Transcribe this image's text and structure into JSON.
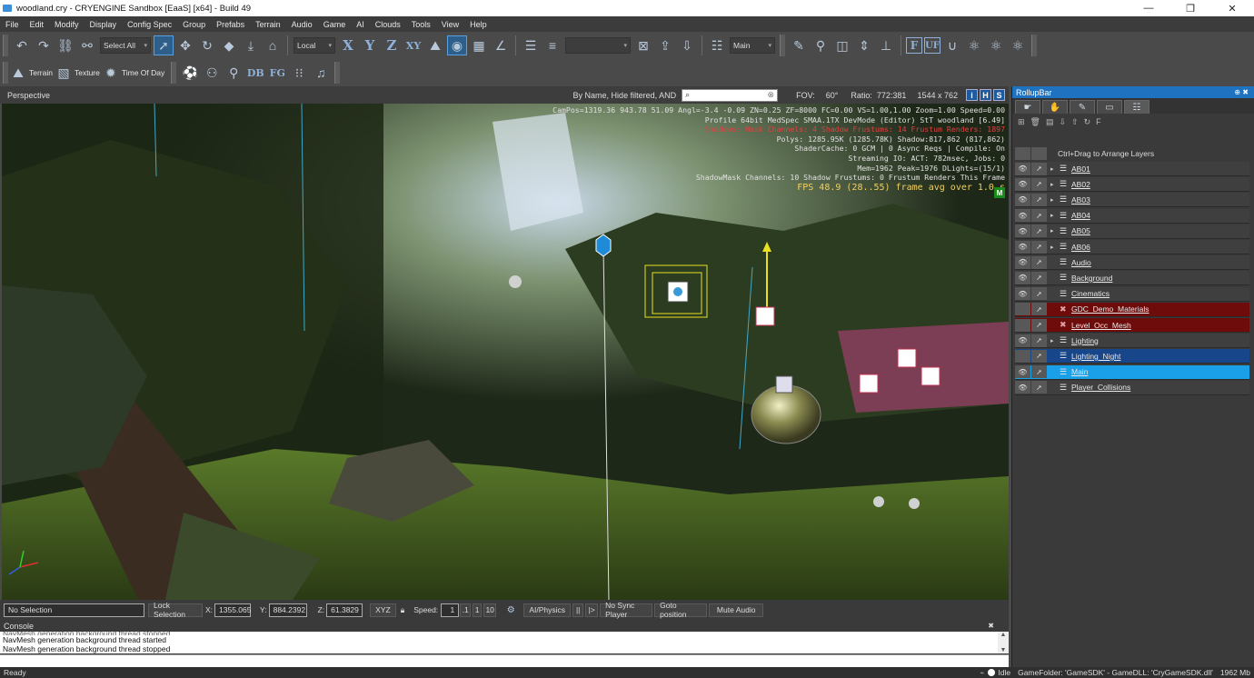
{
  "window": {
    "title": "woodland.cry - CRYENGINE Sandbox [EaaS] [x64] - Build 49"
  },
  "menu": [
    "File",
    "Edit",
    "Modify",
    "Display",
    "Config Spec",
    "Group",
    "Prefabs",
    "Terrain",
    "Audio",
    "Game",
    "AI",
    "Clouds",
    "Tools",
    "View",
    "Help"
  ],
  "toolbar": {
    "select_all": "Select All",
    "coord_space": "Local",
    "layer_combo": "Main",
    "axis_letters": [
      "X",
      "Y",
      "Z",
      "XY"
    ],
    "flags": [
      "F",
      "UF"
    ],
    "terrain": "Terrain",
    "texture": "Texture",
    "time_of_day": "Time Of Day",
    "db": "DB",
    "fg": "FG"
  },
  "viewport": {
    "title": "Perspective",
    "filter_text": "By Name, Hide filtered, AND",
    "search_value": "",
    "fov_label": "FOV:",
    "fov_value": "60°",
    "ratio_label": "Ratio:",
    "ratio_value": "772:381",
    "resolution": "1544 x 762",
    "view_buttons": [
      "i",
      "H",
      "S"
    ],
    "stats": [
      "CamPos=1319.36 943.78 51.09 Angl=-3.4 -0.09 ZN=0.25 ZF=8000 FC=0.00 VS=1.00,1.00 Zoom=1.00 Speed=0.00",
      "Profile 64bit MedSpec SMAA.1TX DevMode (Editor) StT woodland [6.49]",
      "Shadows: Mask Channels: 4 Shadow Frustums: 14 Frustum Renders: 1897",
      "Polys: 1285.95K (1285.78K) Shadow:817,862 (817,862)",
      "ShaderCache: 0 GCM | 0 Async Reqs | Compile: On",
      "Streaming IO: ACT: 782msec, Jobs: 0",
      "Mem=1962 Peak=1976 DLights=(15/1)",
      "ShadowMask Channels: 10 Shadow Frustums: 0 Frustum Renders This Frame",
      "FPS 48.9 (28..55) frame avg over 1.0 s"
    ],
    "m_badge": "M"
  },
  "status": {
    "selection": "No Selection",
    "lock_selection": "Lock Selection",
    "x_label": "X:",
    "x_value": "1355.065",
    "y_label": "Y:",
    "y_value": "884.2392",
    "z_label": "Z:",
    "z_value": "61.3829",
    "xyz": "XYZ",
    "speed_label": "Speed:",
    "speed_value": "1",
    "speed_presets": [
      ".1",
      "1",
      "10"
    ],
    "ai_physics": "AI/Physics",
    "pause": "||",
    "step": "|>",
    "no_sync_player": "No Sync Player",
    "goto_position": "Goto position",
    "mute_audio": "Mute Audio"
  },
  "console": {
    "title": "Console",
    "lines": [
      "NavMesh generation background thread started",
      "NavMesh generation background thread stopped"
    ],
    "clipped_line": "NavMesh generation background thread stopped"
  },
  "bottom": {
    "ready": "Ready",
    "idle": "Idle",
    "game_folder": "GameFolder: 'GameSDK' - GameDLL: 'CryGameSDK.dll'",
    "memory": "1962 Mb"
  },
  "rollup": {
    "title": "RollupBar",
    "hint": "Ctrl+Drag to Arrange Layers",
    "tool_f": "F",
    "layers": [
      {
        "name": "AB01",
        "expandable": true,
        "state": "normal"
      },
      {
        "name": "AB02",
        "expandable": true,
        "state": "normal"
      },
      {
        "name": "AB03",
        "expandable": true,
        "state": "normal"
      },
      {
        "name": "AB04",
        "expandable": true,
        "state": "normal"
      },
      {
        "name": "AB05",
        "expandable": true,
        "state": "normal"
      },
      {
        "name": "AB06",
        "expandable": true,
        "state": "normal"
      },
      {
        "name": "Audio",
        "expandable": false,
        "state": "normal"
      },
      {
        "name": "Background",
        "expandable": false,
        "state": "normal"
      },
      {
        "name": "Cinematics",
        "expandable": false,
        "state": "normal"
      },
      {
        "name": "GDC_Demo_Materials",
        "expandable": false,
        "state": "missing"
      },
      {
        "name": "Level_Occ_Mesh",
        "expandable": false,
        "state": "missing"
      },
      {
        "name": "Lighting",
        "expandable": true,
        "state": "normal"
      },
      {
        "name": "Lighting_Night",
        "expandable": false,
        "state": "hidden-selected"
      },
      {
        "name": "Main",
        "expandable": false,
        "state": "current"
      },
      {
        "name": "Player_Collisions",
        "expandable": false,
        "state": "normal"
      }
    ]
  },
  "colors": {
    "accent": "#1e72c0",
    "missing_layer": "#6e0c0c",
    "current_layer": "#1aa0e8",
    "selected_layer": "#17468a"
  }
}
